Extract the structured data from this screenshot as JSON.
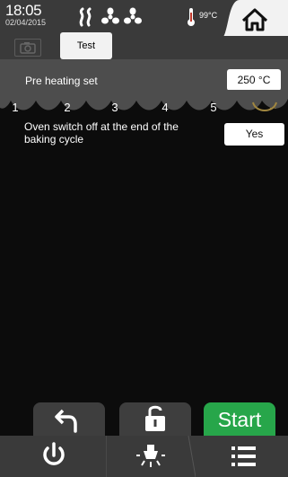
{
  "status_bar": {
    "time": "18:05",
    "date": "02/04/2015",
    "oven_temperature": "99°C",
    "icons": [
      "steam-icon",
      "fan-icon",
      "fan-icon",
      "thermometer-icon",
      "home-icon"
    ]
  },
  "tabs": {
    "camera_icon": "camera-icon",
    "program_name": "Test"
  },
  "preheat": {
    "label": "Pre heating set",
    "value": "250 °C"
  },
  "phases": {
    "items": [
      "1",
      "2",
      "3",
      "4",
      "5"
    ],
    "more": "..."
  },
  "option": {
    "label": "Oven switch off at the end of the baking cycle",
    "value": "Yes"
  },
  "actions": {
    "back_icon": "back-arrow-icon",
    "lock_icon": "unlock-icon",
    "start_label": "Start"
  },
  "nav": {
    "items": [
      "power-icon",
      "light-icon",
      "menu-icon"
    ]
  },
  "colors": {
    "accent_green": "#27a64a",
    "bar_gray": "#3a3a3a",
    "phase_highlight": "#a08640"
  }
}
